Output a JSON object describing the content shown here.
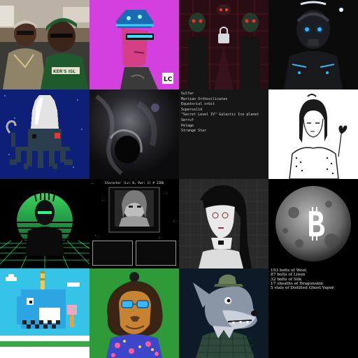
{
  "gallery": {
    "tiles": [
      {
        "name": "photo-two-men-tile",
        "icon": "photo-icon"
      },
      {
        "name": "pink-cyber-punk-tile",
        "icon": "avatar-icon",
        "colors": {
          "bg": "#d43fe0",
          "face": "#d53f86"
        }
      },
      {
        "name": "padlock-demons-tile",
        "icon": "padlock-icon",
        "colors": {
          "bg": "#2a0d12"
        }
      },
      {
        "name": "cyborg-skull-tile",
        "icon": "cyborg-icon",
        "colors": {
          "bg": "#0a0a0a",
          "glow": "#35b6ff"
        }
      },
      {
        "name": "pixel-octopus-tile",
        "icon": "octopus-icon",
        "colors": {
          "bg": "#0e1f77",
          "body": "#2b3e4d"
        }
      },
      {
        "name": "dark-smoke-face-tile",
        "icon": "smoke-icon",
        "colors": {
          "bg": "#141416"
        }
      },
      {
        "name": "word-list-tile",
        "icon": "text-icon"
      },
      {
        "name": "line-art-girl-tile",
        "icon": "line-art-icon"
      },
      {
        "name": "synthwave-bust-tile",
        "icon": "synthwave-icon",
        "colors": {
          "grid": "#17d56c",
          "sun": "#3bd45f"
        }
      },
      {
        "name": "character-sheet-tile",
        "icon": "terminal-icon"
      },
      {
        "name": "monochrome-woman-tile",
        "icon": "portrait-icon"
      },
      {
        "name": "bitcoin-moon-tile",
        "icon": "bitcoin-icon"
      },
      {
        "name": "pixel-narwhal-tile",
        "icon": "narwhal-icon",
        "colors": {
          "bg": "#36c3e8",
          "body": "#2ea5e3"
        }
      },
      {
        "name": "lion-hawaiian-tile",
        "icon": "lion-icon",
        "colors": {
          "bg": "#2f9a38"
        }
      },
      {
        "name": "wolf-character-tile",
        "icon": "wolf-icon",
        "colors": {
          "bg": "#0d1a27"
        }
      },
      {
        "name": "inventory-list-tile",
        "icon": "text-icon"
      }
    ],
    "word_list": [
      "Sulfar",
      "Martian Orthosilicates",
      "Equatorial orbit",
      "Supersolid",
      "\"Secret Level IV\" Galactic Ice planet",
      "Serruf",
      "Pelago",
      "Strange Star"
    ],
    "inventory": [
      "153 bolts of Wool",
      "87 bolts of Linen",
      "32 bolts of Silk",
      "17 sheaths of Dragonskin",
      "5 vials of Distilled Ghost Vapor"
    ],
    "character_sheet": {
      "title": "Character (Lv: 0, Pwr: 1) # 2286"
    },
    "logo_text": "LC"
  }
}
